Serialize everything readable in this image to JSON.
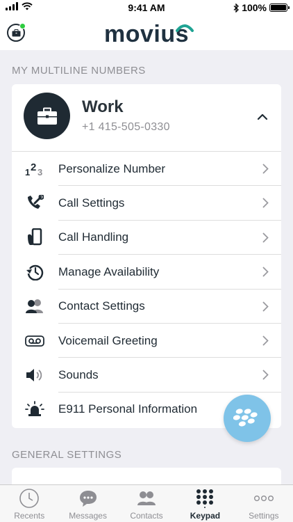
{
  "status_bar": {
    "time": "9:41 AM",
    "battery": "100%"
  },
  "header": {
    "logo": "movius",
    "logo_main": "movi",
    "logo_tail": "us"
  },
  "sections": {
    "multiline_title": "MY MULTILINE NUMBERS",
    "general_title": "GENERAL SETTINGS"
  },
  "number": {
    "name": "Work",
    "value": "+1 415-505-0330"
  },
  "menu": [
    {
      "label": "Personalize Number",
      "icon": "123-icon"
    },
    {
      "label": "Call Settings",
      "icon": "wrench-phone-icon"
    },
    {
      "label": "Call Handling",
      "icon": "phone-hand-icon"
    },
    {
      "label": "Manage Availability",
      "icon": "history-icon"
    },
    {
      "label": "Contact Settings",
      "icon": "contacts-icon"
    },
    {
      "label": "Voicemail Greeting",
      "icon": "voicemail-icon"
    },
    {
      "label": "Sounds",
      "icon": "speaker-icon"
    },
    {
      "label": "E911 Personal Information",
      "icon": "siren-icon"
    }
  ],
  "tabs": [
    {
      "label": "Recents",
      "icon": "clock-icon"
    },
    {
      "label": "Messages",
      "icon": "chat-icon"
    },
    {
      "label": "Contacts",
      "icon": "contacts-icon"
    },
    {
      "label": "Keypad",
      "icon": "keypad-icon",
      "active": true
    },
    {
      "label": "Settings",
      "icon": "more-icon"
    }
  ],
  "colors": {
    "accent": "#1f2a33",
    "logo_accent": "#1fa393",
    "fab": "#7fc3e8",
    "background": "#efeff4"
  }
}
